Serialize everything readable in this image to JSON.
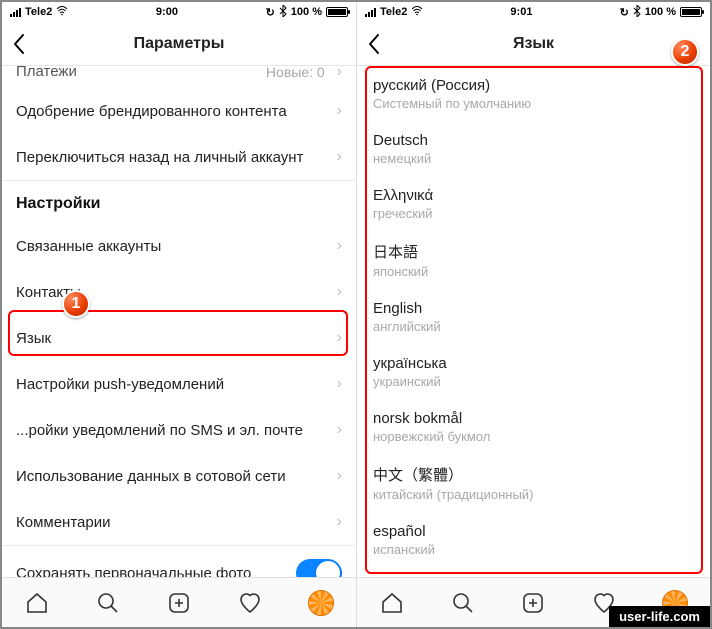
{
  "left": {
    "status": {
      "carrier": "Tele2",
      "time": "9:00",
      "bt": true,
      "battery_text": "100 %"
    },
    "nav_title": "Параметры",
    "partial_row": {
      "label": "Платежи",
      "meta": "Новые: 0"
    },
    "rows": [
      {
        "label": "Одобрение брендированного контента",
        "chev": true
      },
      {
        "label": "Переключиться назад на личный аккаунт",
        "chev": true
      }
    ],
    "section": "Настройки",
    "rows2": [
      {
        "label": "Связанные аккаунты",
        "chev": true
      },
      {
        "label": "Контакты",
        "chev": true
      },
      {
        "label": "Язык",
        "chev": true,
        "highlighted": true
      },
      {
        "label": "Настройки push-уведомлений",
        "chev": true
      },
      {
        "label": "...ройки уведомлений по SMS и эл. почте",
        "chev": true
      },
      {
        "label": "Использование данных в сотовой сети",
        "chev": true
      },
      {
        "label": "Комментарии",
        "chev": true
      }
    ],
    "toggle_row": {
      "label": "Сохранять первоначальные фото",
      "on": true
    }
  },
  "right": {
    "status": {
      "carrier": "Tele2",
      "time": "9:01",
      "bt": true,
      "battery_text": "100 %"
    },
    "nav_title": "Язык",
    "languages": [
      {
        "primary": "русский (Россия)",
        "secondary": "Системный по умолчанию"
      },
      {
        "primary": "Deutsch",
        "secondary": "немецкий"
      },
      {
        "primary": "Ελληνικά",
        "secondary": "греческий"
      },
      {
        "primary": "日本語",
        "secondary": "японский"
      },
      {
        "primary": "English",
        "secondary": "английский"
      },
      {
        "primary": "українська",
        "secondary": "украинский"
      },
      {
        "primary": "norsk bokmål",
        "secondary": "норвежский букмол"
      },
      {
        "primary": "中文（繁體）",
        "secondary": "китайский (традиционный)"
      },
      {
        "primary": "español",
        "secondary": "испанский"
      }
    ]
  },
  "badges": {
    "one": "1",
    "two": "2"
  },
  "watermark": "user-life.com"
}
